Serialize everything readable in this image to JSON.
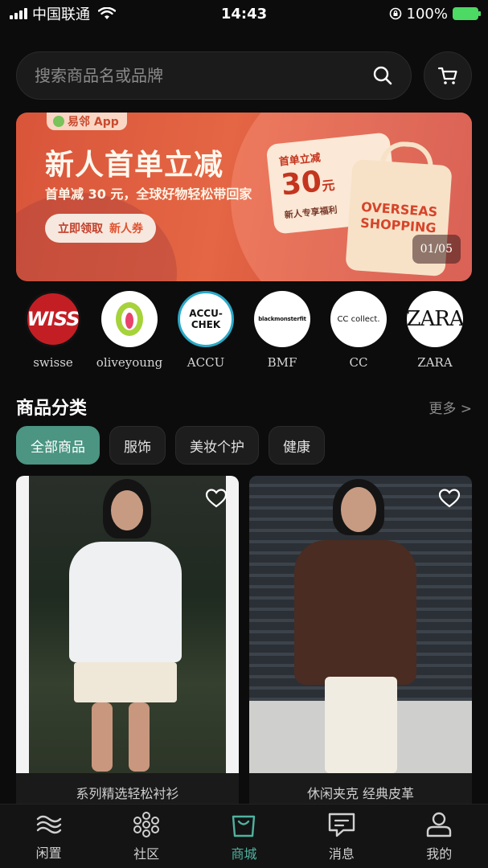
{
  "status_bar": {
    "carrier": "中国联通",
    "time": "14:43",
    "battery": "100%"
  },
  "search": {
    "placeholder": "搜索商品名或品牌"
  },
  "banner": {
    "app_tag": "易邻 App",
    "title": "新人首单立减",
    "subtitle": "首单减 30 元，全球好物轻松带回家",
    "cta_text": "立即领取",
    "cta_highlight": "新人券",
    "coupon_label": "首单立减",
    "coupon_value": "30",
    "coupon_unit": "元",
    "coupon_note": "新人专享福利",
    "bag_line1": "OVERSEAS",
    "bag_line2": "SHOPPING",
    "pager": "01/05"
  },
  "brands": [
    {
      "name": "swisse",
      "logo_text": "WISS"
    },
    {
      "name": "oliveyoung",
      "logo_text": ""
    },
    {
      "name": "ACCU",
      "logo_text": "ACCU-CHEK"
    },
    {
      "name": "BMF",
      "logo_text": "blackmonsterfit"
    },
    {
      "name": "CC",
      "logo_text": "CC collect."
    },
    {
      "name": "ZARA",
      "logo_text": "ZARA"
    }
  ],
  "section": {
    "title": "商品分类",
    "more": "更多 >"
  },
  "categories": [
    {
      "label": "全部商品",
      "active": true
    },
    {
      "label": "服饰",
      "active": false
    },
    {
      "label": "美妆个护",
      "active": false
    },
    {
      "label": "健康",
      "active": false
    }
  ],
  "products": [
    {
      "title": "系列精选轻松衬衫"
    },
    {
      "title": "休闲夹克 经典皮革"
    }
  ],
  "tabs": [
    {
      "label": "闲置",
      "icon": "wave-icon",
      "active": false
    },
    {
      "label": "社区",
      "icon": "community-icon",
      "active": false
    },
    {
      "label": "商城",
      "icon": "shopping-bag-icon",
      "active": true
    },
    {
      "label": "消息",
      "icon": "message-icon",
      "active": false
    },
    {
      "label": "我的",
      "icon": "profile-icon",
      "active": false
    }
  ],
  "colors": {
    "accent": "#4fb3a0",
    "chip_active": "#4b9582",
    "banner": "#e46644",
    "background": "#0c0c0c"
  }
}
